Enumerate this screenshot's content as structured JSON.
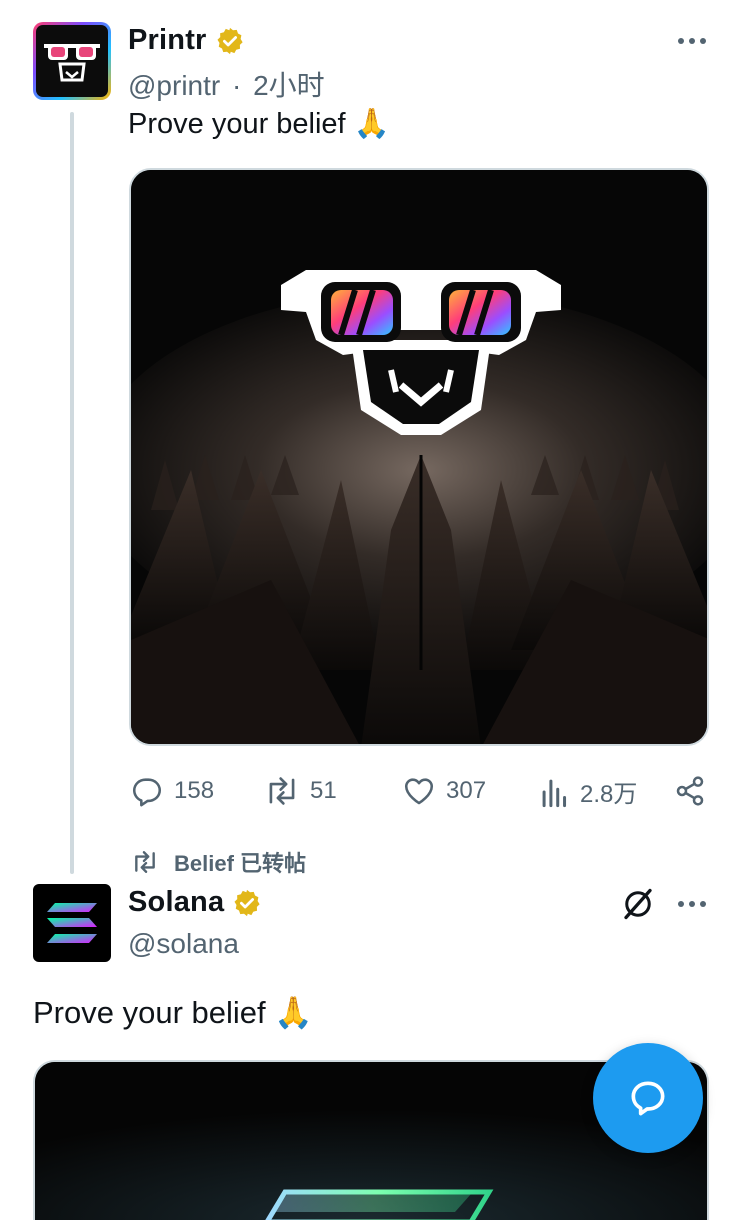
{
  "tweet1": {
    "name": "Printr",
    "handle": "@printr",
    "separator": "·",
    "time": "2小时",
    "text": "Prove your belief",
    "emoji": "🙏",
    "stats": {
      "replies": "158",
      "reposts": "51",
      "likes": "307",
      "views": "2.8万"
    },
    "icons": [
      "verified-badge-icon",
      "more-icon",
      "reply-icon",
      "repost-icon",
      "like-icon",
      "views-icon",
      "share-icon"
    ]
  },
  "repost_label": "Belief 已转帖",
  "tweet2": {
    "name": "Solana",
    "handle": "@solana",
    "text": "Prove your belief",
    "emoji": "🙏",
    "icons": [
      "verified-badge-icon",
      "grok-icon",
      "more-icon"
    ]
  },
  "fab": {
    "icon": "compose-message-icon"
  },
  "colors": {
    "accent": "#1d9bf0",
    "secondary_text": "#536471",
    "verified_gold": "#e2b719",
    "divider": "#cfd9de"
  }
}
